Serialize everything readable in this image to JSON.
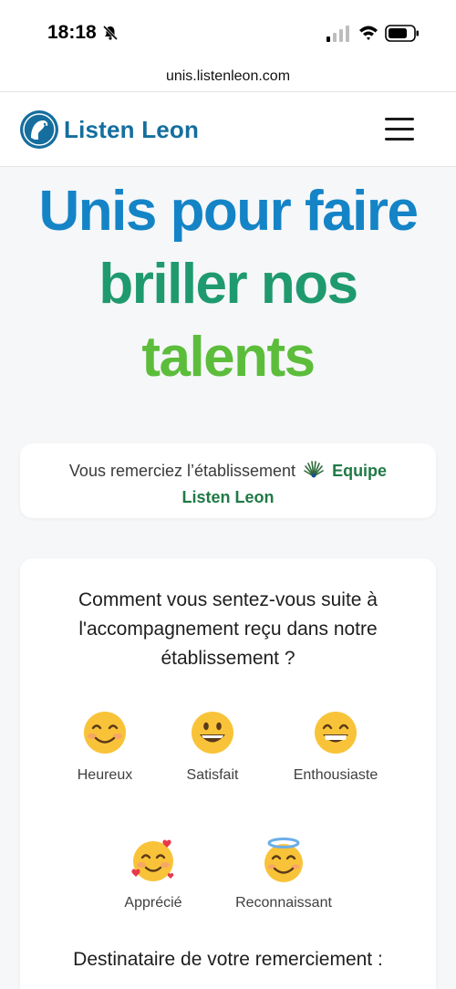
{
  "status_bar": {
    "time": "18:18"
  },
  "browser": {
    "url": "unis.listenleon.com"
  },
  "header": {
    "logo_text": "Listen Leon"
  },
  "hero": {
    "line1": "Unis pour faire",
    "line2": "briller nos",
    "line3": "talents",
    "colors": {
      "line1": "#1484c6",
      "line2": "#1f9a6e",
      "line3": "#5cbd3b"
    }
  },
  "thanks": {
    "prefix": "Vous remerciez l’établissement",
    "org_line1": "Equipe",
    "org_line2": "Listen Leon"
  },
  "survey": {
    "question": "Comment vous sentez-vous suite à l'accompagnement reçu dans notre établissement ?",
    "options": [
      {
        "label": "Heureux",
        "icon": "smiling-face-icon"
      },
      {
        "label": "Satisfait",
        "icon": "grinning-face-icon"
      },
      {
        "label": "Enthousiaste",
        "icon": "beaming-face-icon"
      },
      {
        "label": "Apprécié",
        "icon": "smiling-face-with-hearts-icon"
      },
      {
        "label": "Reconnaissant",
        "icon": "halo-face-icon"
      }
    ]
  },
  "recipient": {
    "label": "Destinataire de votre remerciement :"
  }
}
